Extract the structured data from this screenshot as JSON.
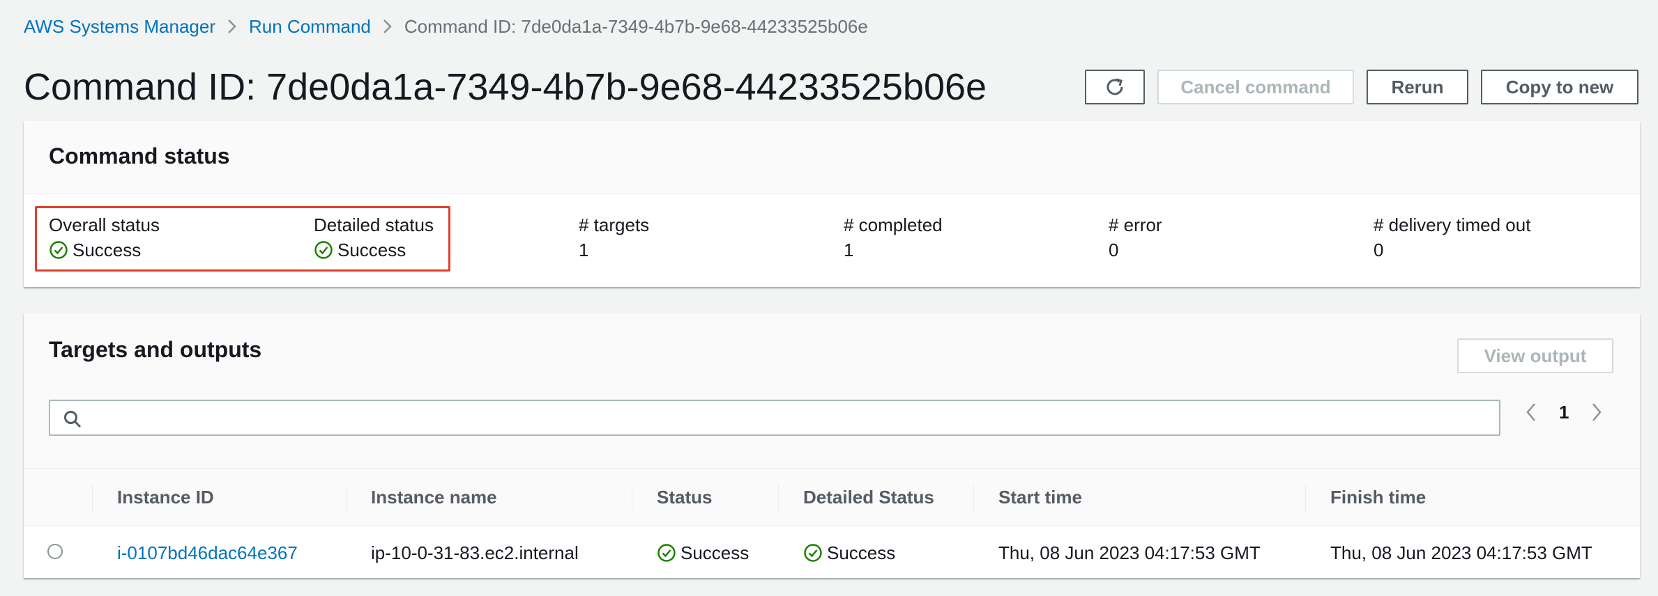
{
  "breadcrumb": {
    "items": [
      "AWS Systems Manager",
      "Run Command"
    ],
    "current": "Command ID: 7de0da1a-7349-4b7b-9e68-44233525b06e"
  },
  "header": {
    "title": "Command ID: 7de0da1a-7349-4b7b-9e68-44233525b06e",
    "refresh_icon": "refresh-icon",
    "cancel_label": "Cancel command",
    "rerun_label": "Rerun",
    "copy_label": "Copy to new"
  },
  "command_status": {
    "title": "Command status",
    "overall_status_label": "Overall status",
    "overall_status_value": "Success",
    "detailed_status_label": "Detailed status",
    "detailed_status_value": "Success",
    "targets_label": "# targets",
    "targets_value": "1",
    "completed_label": "# completed",
    "completed_value": "1",
    "error_label": "# error",
    "error_value": "0",
    "timed_out_label": "# delivery timed out",
    "timed_out_value": "0"
  },
  "targets": {
    "title": "Targets and outputs",
    "view_output_label": "View output",
    "search_placeholder": "",
    "page": "1",
    "columns": [
      "Instance ID",
      "Instance name",
      "Status",
      "Detailed Status",
      "Start time",
      "Finish time"
    ],
    "rows": [
      {
        "instance_id": "i-0107bd46dac64e367",
        "instance_name": "ip-10-0-31-83.ec2.internal",
        "status": "Success",
        "detailed_status": "Success",
        "start_time": "Thu, 08 Jun 2023 04:17:53 GMT",
        "finish_time": "Thu, 08 Jun 2023 04:17:53 GMT"
      }
    ]
  },
  "colors": {
    "link": "#0073bb",
    "success": "#1d8102",
    "highlight": "#e0402b"
  }
}
